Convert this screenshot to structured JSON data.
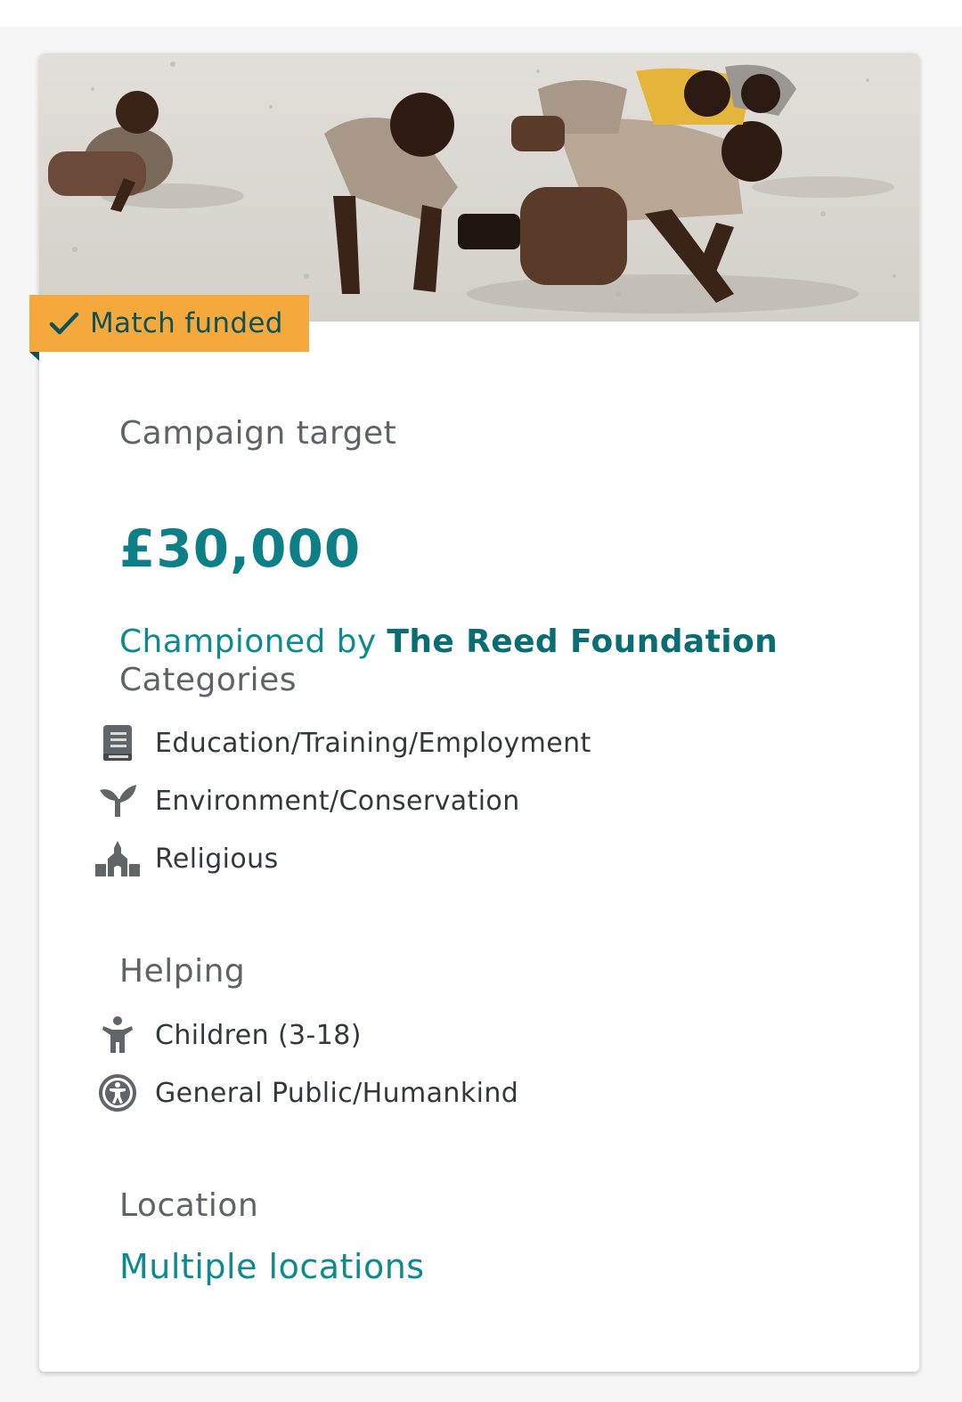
{
  "badge": {
    "label": "Match funded",
    "icon": "check-icon"
  },
  "campaign": {
    "target_label": "Campaign target",
    "target_value": "£30,000",
    "championed_prefix": "Championed by",
    "champion_name": "The Reed Foundation"
  },
  "categories": {
    "heading": "Categories",
    "items": [
      {
        "label": "Education/Training/Employment",
        "icon": "book-icon"
      },
      {
        "label": "Environment/Conservation",
        "icon": "sprout-icon"
      },
      {
        "label": "Religious",
        "icon": "church-icon"
      }
    ]
  },
  "helping": {
    "heading": "Helping",
    "items": [
      {
        "label": "Children (3-18)",
        "icon": "child-icon"
      },
      {
        "label": "General Public/Humankind",
        "icon": "accessibility-icon"
      }
    ]
  },
  "location": {
    "heading": "Location",
    "value": "Multiple locations"
  },
  "colors": {
    "accent": "#0d7f86",
    "badge": "#f5a93c",
    "muted_text": "#5e6366"
  }
}
